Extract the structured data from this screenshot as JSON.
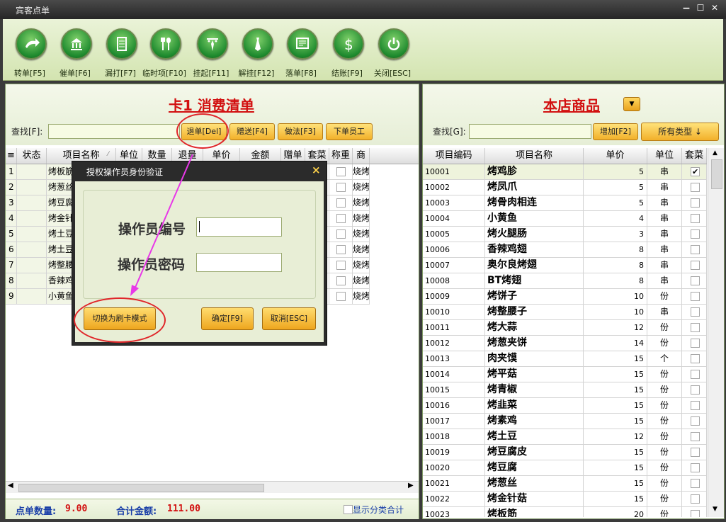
{
  "window": {
    "title": "宾客点单",
    "minimize": "−",
    "maximize": "☐",
    "close": "✕"
  },
  "toolbar": [
    {
      "label": "转单[F5]",
      "icon": "transfer-arrow-icon"
    },
    {
      "label": "催单[F6]",
      "icon": "bank-icon"
    },
    {
      "label": "漏打[F7]",
      "icon": "document-icon"
    },
    {
      "label": "临时项[F10]",
      "icon": "spoon-fork-icon"
    },
    {
      "label": "挂起[F11]",
      "icon": "hang-tie-icon"
    },
    {
      "label": "解挂[F12]",
      "icon": "tie-icon"
    },
    {
      "label": "落单[F8]",
      "icon": "order-screen-icon"
    },
    {
      "label": "结账[F9]",
      "icon": "dollar-icon"
    },
    {
      "label": "关闭[ESC]",
      "icon": "power-icon"
    }
  ],
  "left": {
    "title": "卡1 消费清单",
    "search_label": "查找[F]:",
    "buttons": [
      "退单[Del]",
      "赠送[F4]",
      "做法[F3]",
      "下单员工"
    ],
    "columns": [
      "≡",
      "状态",
      "项目名称",
      "单位",
      "数量",
      "退量",
      "单价",
      "金额",
      "赠单",
      "套菜",
      "称重",
      "商"
    ],
    "sort_mark": "⁄",
    "rows": [
      {
        "n": "1",
        "name": "烤板筋",
        "cat": "烧烤"
      },
      {
        "n": "2",
        "name": "烤葱丝",
        "cat": "烧烤"
      },
      {
        "n": "3",
        "name": "烤豆腐",
        "cat": "烧烤"
      },
      {
        "n": "4",
        "name": "烤金针",
        "cat": "烧烤"
      },
      {
        "n": "5",
        "name": "烤土豆",
        "cat": "烧烤"
      },
      {
        "n": "6",
        "name": "烤土豆",
        "cat": "烧烤"
      },
      {
        "n": "7",
        "name": "烤整腰",
        "cat": "烧烤"
      },
      {
        "n": "8",
        "name": "香辣鸡",
        "cat": "烧烤"
      },
      {
        "n": "9",
        "name": "小黄鱼",
        "cat": "烧烤"
      }
    ],
    "footer": {
      "count_label": "点单数量:",
      "count": "9.00",
      "total_label": "合计金额:",
      "total": "111.00",
      "show_cat": "显示分类合计"
    }
  },
  "right": {
    "title": "本店商品",
    "search_label": "查找[G]:",
    "add_button": "增加[F2]",
    "type_button": "所有类型 ↓",
    "columns": [
      "项目编码",
      "项目名称",
      "单价",
      "单位",
      "套菜"
    ],
    "items": [
      {
        "code": "10001",
        "name": "烤鸡胗",
        "price": "5",
        "unit": "串",
        "set": true
      },
      {
        "code": "10002",
        "name": "烤凤爪",
        "price": "5",
        "unit": "串",
        "set": false
      },
      {
        "code": "10003",
        "name": "烤骨肉相连",
        "price": "5",
        "unit": "串",
        "set": false
      },
      {
        "code": "10004",
        "name": "小黄鱼",
        "price": "4",
        "unit": "串",
        "set": false
      },
      {
        "code": "10005",
        "name": "烤火腿肠",
        "price": "3",
        "unit": "串",
        "set": false
      },
      {
        "code": "10006",
        "name": "香辣鸡翅",
        "price": "8",
        "unit": "串",
        "set": false
      },
      {
        "code": "10007",
        "name": "奥尔良烤翅",
        "price": "8",
        "unit": "串",
        "set": false
      },
      {
        "code": "10008",
        "name": "BT烤翅",
        "price": "8",
        "unit": "串",
        "set": false
      },
      {
        "code": "10009",
        "name": "烤饼子",
        "price": "10",
        "unit": "份",
        "set": false
      },
      {
        "code": "10010",
        "name": "烤整腰子",
        "price": "10",
        "unit": "串",
        "set": false
      },
      {
        "code": "10011",
        "name": "烤大蒜",
        "price": "12",
        "unit": "份",
        "set": false
      },
      {
        "code": "10012",
        "name": "烤葱夹饼",
        "price": "14",
        "unit": "份",
        "set": false
      },
      {
        "code": "10013",
        "name": "肉夹馍",
        "price": "15",
        "unit": "个",
        "set": false
      },
      {
        "code": "10014",
        "name": "烤平菇",
        "price": "15",
        "unit": "份",
        "set": false
      },
      {
        "code": "10015",
        "name": "烤青椒",
        "price": "15",
        "unit": "份",
        "set": false
      },
      {
        "code": "10016",
        "name": "烤韭菜",
        "price": "15",
        "unit": "份",
        "set": false
      },
      {
        "code": "10017",
        "name": "烤素鸡",
        "price": "15",
        "unit": "份",
        "set": false
      },
      {
        "code": "10018",
        "name": "烤土豆",
        "price": "12",
        "unit": "份",
        "set": false
      },
      {
        "code": "10019",
        "name": "烤豆腐皮",
        "price": "15",
        "unit": "份",
        "set": false
      },
      {
        "code": "10020",
        "name": "烤豆腐",
        "price": "15",
        "unit": "份",
        "set": false
      },
      {
        "code": "10021",
        "name": "烤葱丝",
        "price": "15",
        "unit": "份",
        "set": false
      },
      {
        "code": "10022",
        "name": "烤金针菇",
        "price": "15",
        "unit": "份",
        "set": false
      },
      {
        "code": "10023",
        "name": "烤板筋",
        "price": "20",
        "unit": "份",
        "set": false
      }
    ]
  },
  "dialog": {
    "title": "授权操作员身份验证",
    "close": "×",
    "operator_id_label": "操作员编号",
    "operator_id_value": "",
    "operator_pwd_label": "操作员密码",
    "operator_pwd_value": "",
    "card_mode_button": "切换为刷卡模式",
    "ok_button": "确定[F9]",
    "cancel_button": "取消[ESC]"
  },
  "colors": {
    "title_red": "#d21010",
    "button_yellow": "#f2b02a",
    "annotation_red": "#e0262a",
    "arrow_magenta": "#e838e8"
  }
}
